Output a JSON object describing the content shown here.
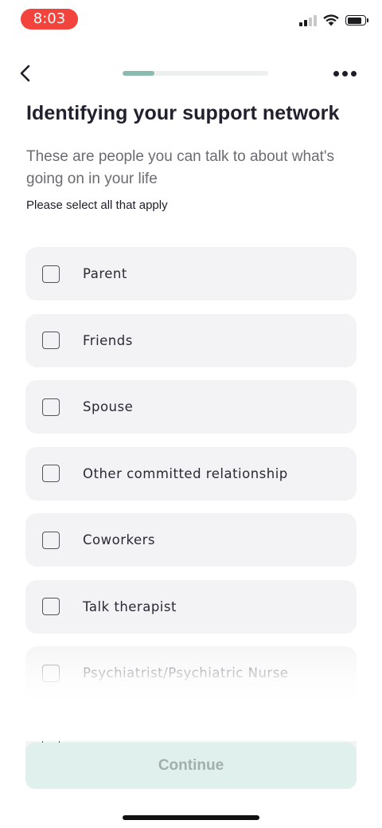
{
  "status_bar": {
    "time": "8:03",
    "icons": [
      "signal-icon",
      "wifi-icon",
      "battery-icon"
    ]
  },
  "nav": {
    "back_icon": "chevron-left-icon",
    "more_icon": "more-horizontal-icon",
    "progress": 0.22
  },
  "header": {
    "title": "Identifying your support network",
    "subtitle": "These are people you can talk to about what's going on in your life",
    "instruction": "Please select all that apply"
  },
  "options": [
    {
      "label": "Parent",
      "checked": false
    },
    {
      "label": "Friends",
      "checked": false
    },
    {
      "label": "Spouse",
      "checked": false
    },
    {
      "label": "Other committed relationship",
      "checked": false
    },
    {
      "label": "Coworkers",
      "checked": false
    },
    {
      "label": "Talk therapist",
      "checked": false
    },
    {
      "label": "Psychiatrist/Psychiatric Nurse",
      "checked": false
    }
  ],
  "footer": {
    "continue_label": "Continue",
    "continue_enabled": false
  },
  "colors": {
    "time_pill": "#f2443c",
    "progress_fill": "#8bbab0",
    "option_bg": "#f3f2f4",
    "continue_bg": "#e0f0ed",
    "continue_text": "#a3aeae"
  }
}
